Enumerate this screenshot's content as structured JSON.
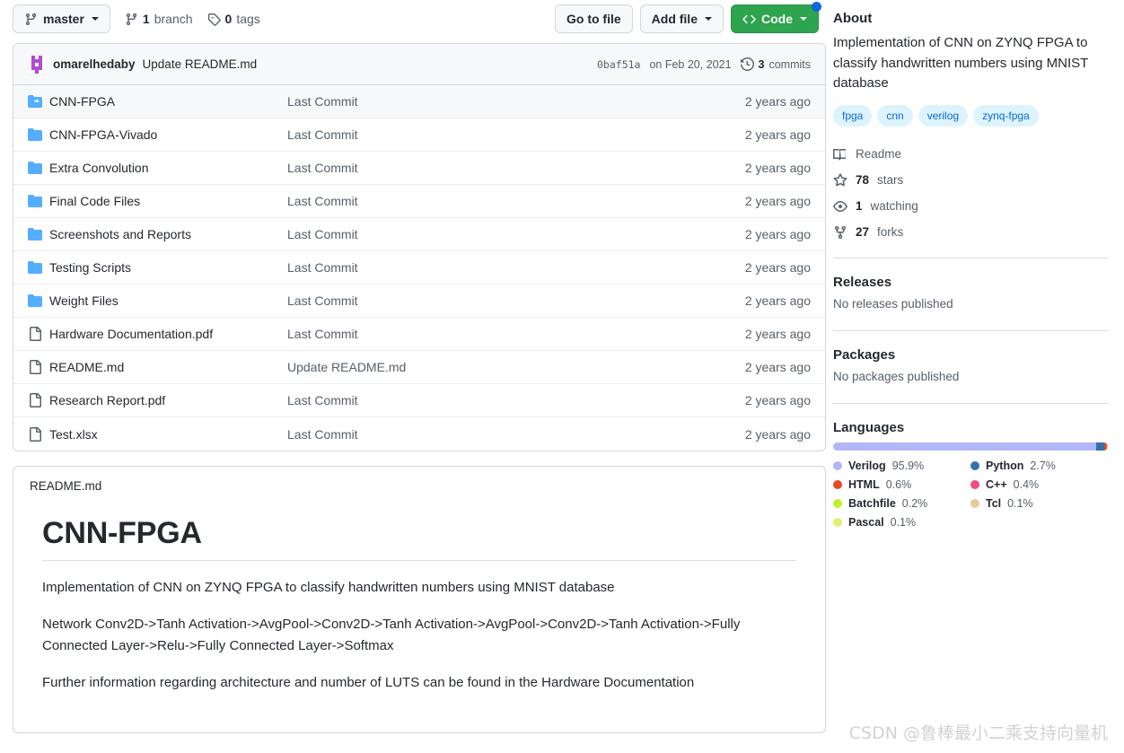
{
  "toolbar": {
    "branch_label": "master",
    "branches": "1 branch",
    "branch_count": "1",
    "branch_word": "branch",
    "tags": "0 tags",
    "tag_count": "0",
    "tag_word": "tags",
    "go_to_file": "Go to file",
    "add_file": "Add file",
    "code": "Code"
  },
  "commit": {
    "author": "omarelhedaby",
    "message": "Update README.md",
    "sha": "0baf51a",
    "date": "on Feb 20, 2021",
    "commits_count": "3",
    "commits_word": "commits"
  },
  "files": {
    "rows": [
      {
        "name": "CNN-FPGA",
        "icon": "submodule-icon",
        "commit": "Last Commit",
        "age": "2 years ago"
      },
      {
        "name": "CNN-FPGA-Vivado",
        "icon": "folder-icon",
        "commit": "Last Commit",
        "age": "2 years ago"
      },
      {
        "name": "Extra Convolution",
        "icon": "folder-icon",
        "commit": "Last Commit",
        "age": "2 years ago"
      },
      {
        "name": "Final Code Files",
        "icon": "folder-icon",
        "commit": "Last Commit",
        "age": "2 years ago"
      },
      {
        "name": "Screenshots and Reports",
        "icon": "folder-icon",
        "commit": "Last Commit",
        "age": "2 years ago"
      },
      {
        "name": "Testing Scripts",
        "icon": "folder-icon",
        "commit": "Last Commit",
        "age": "2 years ago"
      },
      {
        "name": "Weight Files",
        "icon": "folder-icon",
        "commit": "Last Commit",
        "age": "2 years ago"
      },
      {
        "name": "Hardware Documentation.pdf",
        "icon": "file-icon",
        "commit": "Last Commit",
        "age": "2 years ago"
      },
      {
        "name": "README.md",
        "icon": "file-icon",
        "commit": "Update README.md",
        "age": "2 years ago"
      },
      {
        "name": "Research Report.pdf",
        "icon": "file-icon",
        "commit": "Last Commit",
        "age": "2 years ago"
      },
      {
        "name": "Test.xlsx",
        "icon": "file-icon",
        "commit": "Last Commit",
        "age": "2 years ago"
      }
    ]
  },
  "readme": {
    "filename": "README.md",
    "title": "CNN-FPGA",
    "p1": "Implementation of CNN on ZYNQ FPGA to classify handwritten numbers using MNIST database",
    "p2": "Network Conv2D->Tanh Activation->AvgPool->Conv2D->Tanh Activation->AvgPool->Conv2D->Tanh Activation->Fully Connected Layer->Relu->Fully Connected Layer->Softmax",
    "p3": "Further information regarding architecture and number of LUTS can be found in the Hardware Documentation"
  },
  "about": {
    "heading": "About",
    "description": "Implementation of CNN on ZYNQ FPGA to classify handwritten numbers using MNIST database",
    "topics": [
      "fpga",
      "cnn",
      "verilog",
      "zynq-fpga"
    ],
    "readme_label": "Readme",
    "stars_count": "78",
    "stars_word": "stars",
    "watching_count": "1",
    "watching_word": "watching",
    "forks_count": "27",
    "forks_word": "forks"
  },
  "releases": {
    "heading": "Releases",
    "empty": "No releases published"
  },
  "packages": {
    "heading": "Packages",
    "empty": "No packages published"
  },
  "languages": {
    "heading": "Languages",
    "items": [
      {
        "name": "Verilog",
        "percent": "95.9%",
        "value": 95.9,
        "color": "#b2b7f8"
      },
      {
        "name": "Python",
        "percent": "2.7%",
        "value": 2.7,
        "color": "#3572A5"
      },
      {
        "name": "HTML",
        "percent": "0.6%",
        "value": 0.6,
        "color": "#e34c26"
      },
      {
        "name": "C++",
        "percent": "0.4%",
        "value": 0.4,
        "color": "#f34b7d"
      },
      {
        "name": "Batchfile",
        "percent": "0.2%",
        "value": 0.2,
        "color": "#C1F12E"
      },
      {
        "name": "Tcl",
        "percent": "0.1%",
        "value": 0.1,
        "color": "#e4cc98"
      },
      {
        "name": "Pascal",
        "percent": "0.1%",
        "value": 0.1,
        "color": "#E3F171"
      }
    ]
  },
  "watermark": "CSDN @鲁棒最小二乘支持向量机",
  "colors": {
    "accent_green": "#2da44e",
    "accent_blue": "#0969da",
    "folder_blue": "#54aeff",
    "border": "#d0d7de",
    "muted_text": "#57606a"
  }
}
